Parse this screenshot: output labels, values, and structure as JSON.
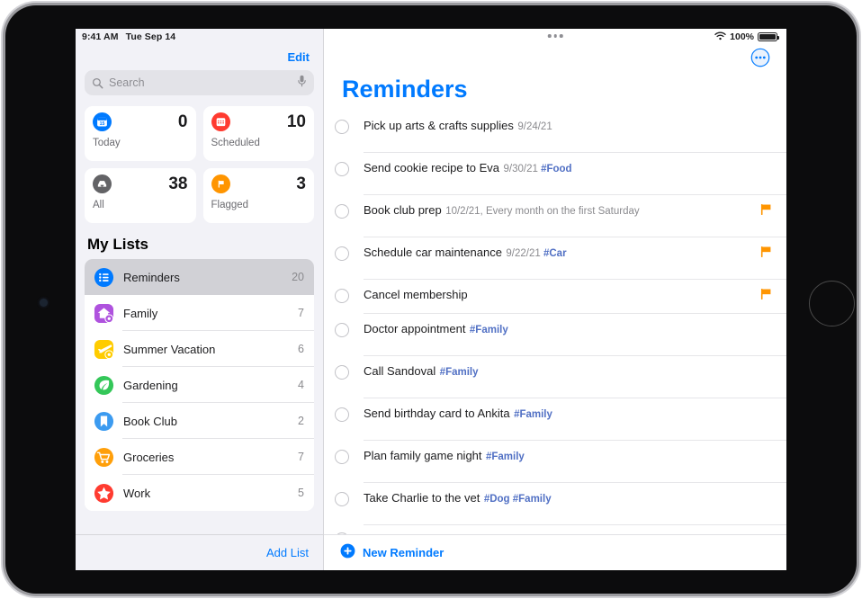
{
  "device": {
    "orientation": "landscape",
    "home_button": "home-button",
    "front_camera": "front-camera"
  },
  "status_bar": {
    "time": "9:41 AM",
    "date": "Tue Sep 14",
    "wifi_icon": "wifi-icon",
    "battery_percent": "100%",
    "battery_icon": "battery-full-icon"
  },
  "sidebar": {
    "edit_label": "Edit",
    "search": {
      "placeholder": "Search",
      "icon": "search-icon",
      "mic_icon": "microphone-icon"
    },
    "smart_lists": [
      {
        "label": "Today",
        "count": "0",
        "icon": "calendar-today-icon",
        "color": "#007aff",
        "badge_day": "15"
      },
      {
        "label": "Scheduled",
        "count": "10",
        "icon": "calendar-scheduled-icon",
        "color": "#ff3b30"
      },
      {
        "label": "All",
        "count": "38",
        "icon": "inbox-tray-icon",
        "color": "#636366"
      },
      {
        "label": "Flagged",
        "count": "3",
        "icon": "flag-icon",
        "color": "#ff9500"
      }
    ],
    "my_lists_heading": "My Lists",
    "lists": [
      {
        "name": "Reminders",
        "count": "20",
        "icon": "bullet-list-icon",
        "color": "#007aff",
        "shape": "circle",
        "shared": false,
        "selected": true
      },
      {
        "name": "Family",
        "count": "7",
        "icon": "house-icon",
        "color": "#af52de",
        "shape": "squircle",
        "shared": true,
        "selected": false
      },
      {
        "name": "Summer Vacation",
        "count": "6",
        "icon": "airplane-icon",
        "color": "#ffcc00",
        "shape": "squircle",
        "shared": true,
        "selected": false
      },
      {
        "name": "Gardening",
        "count": "4",
        "icon": "leaf-icon",
        "color": "#34c759",
        "shape": "circle",
        "shared": false,
        "selected": false
      },
      {
        "name": "Book Club",
        "count": "2",
        "icon": "bookmark-icon",
        "color": "#3c9bf0",
        "shape": "circle",
        "shared": false,
        "selected": false
      },
      {
        "name": "Groceries",
        "count": "7",
        "icon": "shopping-cart-icon",
        "color": "#ff9f0a",
        "shape": "circle",
        "shared": false,
        "selected": false
      },
      {
        "name": "Work",
        "count": "5",
        "icon": "star-icon",
        "color": "#ff3b30",
        "shape": "circle",
        "shared": false,
        "selected": false
      }
    ],
    "add_list_label": "Add List"
  },
  "detail": {
    "multitask_handle_icon": "multitasking-handle-icon",
    "more_button_icon": "more-ellipsis-circle-icon",
    "title": "Reminders",
    "title_color": "#007aff",
    "reminders": [
      {
        "title": "Pick up arts & crafts supplies",
        "date": "9/24/21",
        "tags": "",
        "flagged": false
      },
      {
        "title": "Send cookie recipe to Eva",
        "date": "9/30/21",
        "tags": "#Food",
        "flagged": false
      },
      {
        "title": "Book club prep",
        "date": "10/2/21, Every month on the first Saturday",
        "tags": "",
        "flagged": true
      },
      {
        "title": "Schedule car maintenance",
        "date": "9/22/21",
        "tags": "#Car",
        "flagged": true
      },
      {
        "title": "Cancel membership",
        "date": "",
        "tags": "",
        "flagged": true
      },
      {
        "title": "Doctor appointment",
        "date": "",
        "tags": "#Family",
        "flagged": false
      },
      {
        "title": "Call Sandoval",
        "date": "",
        "tags": "#Family",
        "flagged": false
      },
      {
        "title": "Send birthday card to Ankita",
        "date": "",
        "tags": "#Family",
        "flagged": false
      },
      {
        "title": "Plan family game night",
        "date": "",
        "tags": "#Family",
        "flagged": false
      },
      {
        "title": "Take Charlie to the vet",
        "date": "",
        "tags": "#Dog #Family",
        "flagged": false
      },
      {
        "title": "",
        "date": "",
        "tags": "",
        "flagged": false
      }
    ],
    "new_reminder_label": "New Reminder",
    "new_reminder_icon": "plus-circle-icon",
    "flag_color": "#ff9500",
    "tag_color": "#5170c4"
  }
}
